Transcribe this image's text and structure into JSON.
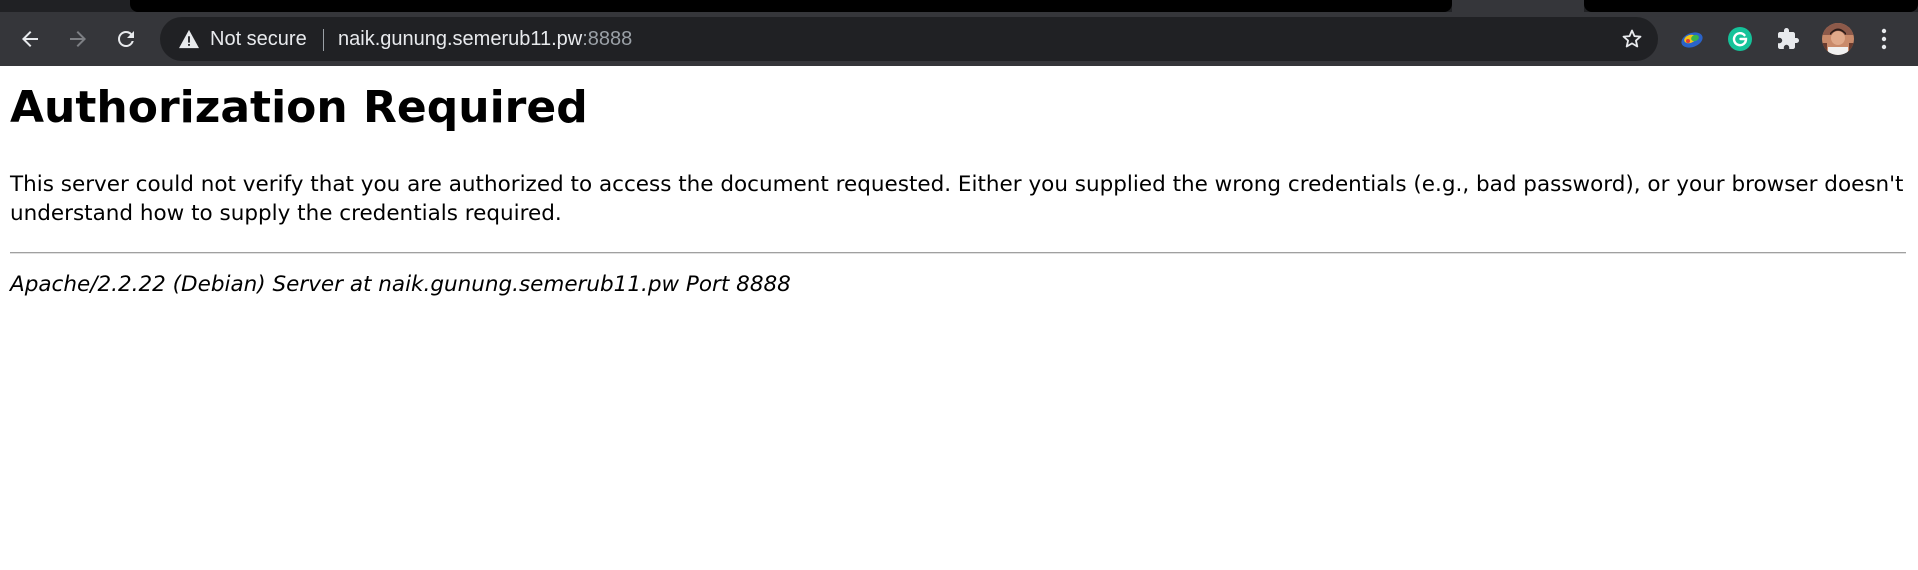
{
  "browser": {
    "security_label": "Not secure",
    "url_host": "naik.gunung.semerub11.pw",
    "url_port": ":8888",
    "colors": {
      "frame": "#202124",
      "toolbar": "#35363a",
      "omnibox": "#202124",
      "icon": "#e8eaed",
      "icon_disabled": "#7d7f83",
      "grammarly_green": "#15c39a"
    },
    "icons": {
      "back": "arrow-left-icon",
      "forward": "arrow-right-icon",
      "reload": "reload-icon",
      "security": "warning-triangle-icon",
      "bookmark": "star-outline-icon",
      "extension_1": "color-extension-icon",
      "extension_2": "grammarly-icon",
      "extensions_menu": "puzzle-piece-icon",
      "profile": "profile-avatar",
      "menu": "kebab-menu-icon"
    }
  },
  "page": {
    "heading": "Authorization Required",
    "message": "This server could not verify that you are authorized to access the document requested. Either you supplied the wrong credentials (e.g., bad password), or your browser doesn't understand how to supply the credentials required.",
    "server_signature": "Apache/2.2.22 (Debian) Server at naik.gunung.semerub11.pw Port 8888"
  }
}
